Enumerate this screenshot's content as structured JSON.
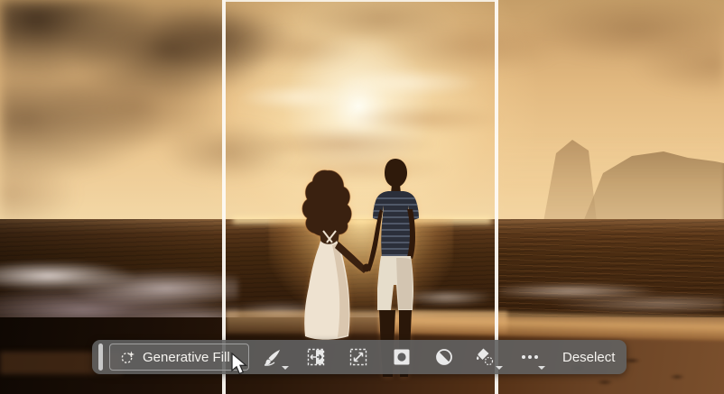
{
  "taskbar": {
    "generative_fill": {
      "label": "Generative Fill",
      "icon": "selection-sparkle-icon"
    },
    "deselect": {
      "label": "Deselect"
    },
    "tools": [
      {
        "id": "selection-brush",
        "icon": "brush-icon",
        "dropdown": true
      },
      {
        "id": "invert-selection",
        "icon": "invert-selection-icon",
        "dropdown": false
      },
      {
        "id": "transform-selection",
        "icon": "transform-selection-icon",
        "dropdown": false
      },
      {
        "id": "create-mask",
        "icon": "mask-icon",
        "dropdown": false
      },
      {
        "id": "create-adjustment",
        "icon": "adjustment-circle-icon",
        "dropdown": false
      },
      {
        "id": "fill-selection",
        "icon": "paint-bucket-icon",
        "dropdown": true
      },
      {
        "id": "more-options",
        "icon": "ellipsis-icon",
        "dropdown": true
      }
    ],
    "colors": {
      "bar_background": "#616161",
      "text": "#f5f3ef",
      "button_border": "#a0a0a0",
      "grip": "#c8c8c8"
    }
  },
  "canvas": {
    "selection_guides": {
      "color": "#fdfaf4",
      "vertical_lines": 2,
      "top_line": true
    },
    "scene_description": "Silhouetted couple holding hands on a beach at golden sunset, ocean waves, dark clouds left, hazy mountains right",
    "cursor": "arrow"
  }
}
